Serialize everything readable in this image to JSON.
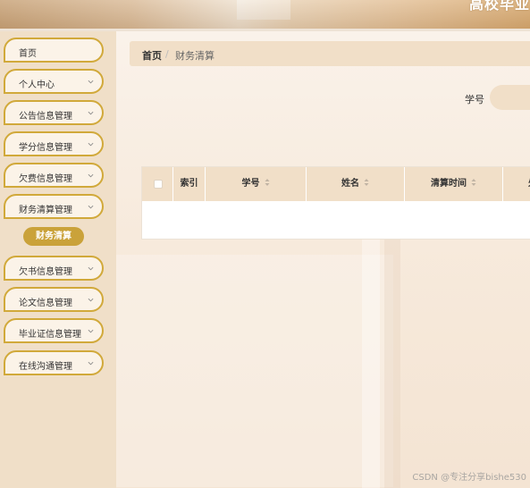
{
  "header": {
    "title": "高校毕业"
  },
  "sidebar": {
    "items": [
      {
        "label": "首页",
        "has_arrow": false
      },
      {
        "label": "个人中心",
        "has_arrow": true
      },
      {
        "label": "公告信息管理",
        "has_arrow": true
      },
      {
        "label": "学分信息管理",
        "has_arrow": true
      },
      {
        "label": "欠费信息管理",
        "has_arrow": true
      },
      {
        "label": "财务清算管理",
        "has_arrow": true
      },
      {
        "label": "欠书信息管理",
        "has_arrow": true
      },
      {
        "label": "论文信息管理",
        "has_arrow": true
      },
      {
        "label": "毕业证信息管理",
        "has_arrow": true
      },
      {
        "label": "在线沟通管理",
        "has_arrow": true
      }
    ],
    "active_sub_item": "财务清算"
  },
  "breadcrumb": {
    "home": "首页",
    "separator": "/",
    "current": "财务清算"
  },
  "search": {
    "label": "学号",
    "placeholder": ""
  },
  "table": {
    "columns": [
      {
        "label": "索引",
        "sortable": false
      },
      {
        "label": "学号",
        "sortable": true
      },
      {
        "label": "姓名",
        "sortable": true
      },
      {
        "label": "清算时间",
        "sortable": true
      },
      {
        "label": "处",
        "sortable": false
      }
    ],
    "rows": []
  },
  "watermark": "CSDN @专注分享bishe530",
  "colors": {
    "accent_gold": "#caa23a",
    "menu_border": "#d1a93a",
    "panel_beige": "#f1dfc8"
  },
  "icons": {
    "menu_arrow": "chevron-down-icon",
    "sort": "sort-icon"
  }
}
